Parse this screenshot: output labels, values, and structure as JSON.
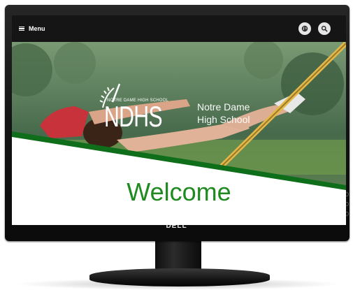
{
  "menu": {
    "label": "Menu"
  },
  "brand": {
    "small_text": "NOTRE DAME HIGH SCHOOL",
    "acronym": "NDHS",
    "name_line1": "Notre Dame",
    "name_line2": "High School"
  },
  "hero": {
    "heading": "Welcome"
  },
  "monitor": {
    "logo": "DELL"
  },
  "colors": {
    "topbar": "#151515",
    "accent_green": "#1f8a1f",
    "swoosh_green": "#0f6e1a"
  }
}
